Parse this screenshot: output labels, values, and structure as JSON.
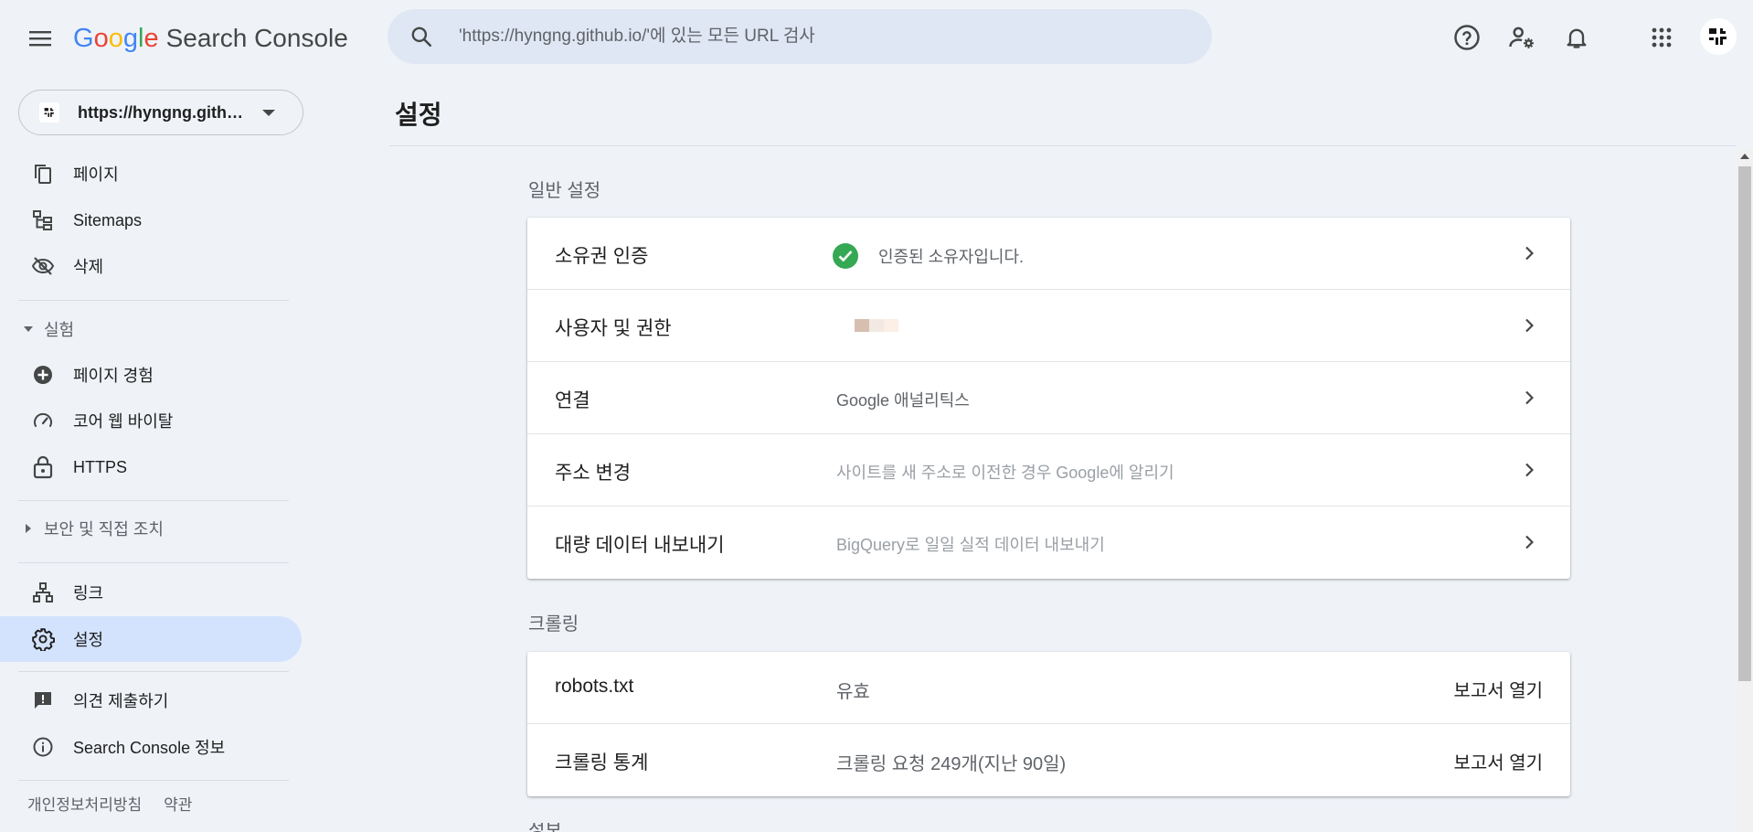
{
  "header": {
    "logo_letters": [
      "G",
      "o",
      "o",
      "g",
      "l",
      "e"
    ],
    "product": "Search Console",
    "search_placeholder": "'https://hyngng.github.io/'에 있는 모든 URL 검사"
  },
  "sidebar": {
    "property_label": "https://hyngng.github.io/",
    "items": [
      {
        "label": "페이지",
        "icon": "pages-icon"
      },
      {
        "label": "Sitemaps",
        "icon": "sitemap-icon"
      },
      {
        "label": "삭제",
        "icon": "visibility-off-icon"
      }
    ],
    "section_experience": "실험",
    "experience_items": [
      {
        "label": "페이지 경험",
        "icon": "plus-circle-icon"
      },
      {
        "label": "코어 웹 바이탈",
        "icon": "speed-gauge-icon"
      },
      {
        "label": "HTTPS",
        "icon": "lock-icon"
      }
    ],
    "section_security": "보안 및 직접 조치",
    "links_label": "링크",
    "settings_label": "설정",
    "feedback_label": "의견 제출하기",
    "about_label": "Search Console 정보",
    "footer": {
      "privacy": "개인정보처리방침",
      "terms": "약관"
    }
  },
  "main": {
    "title": "설정",
    "general_title": "일반 설정",
    "general_rows": [
      {
        "name": "소유권 인증",
        "value": "인증된 소유자입니다."
      },
      {
        "name": "사용자 및 권한",
        "value": ""
      },
      {
        "name": "연결",
        "value": "Google 애널리틱스"
      },
      {
        "name": "주소 변경",
        "value": "사이트를 새 주소로 이전한 경우 Google에 알리기"
      },
      {
        "name": "대량 데이터 내보내기",
        "value": "BigQuery로 일일 실적 데이터 내보내기"
      }
    ],
    "crawl_title": "크롤링",
    "crawl_rows": [
      {
        "name": "robots.txt",
        "value": "유효",
        "action": "보고서 열기"
      },
      {
        "name": "크롤링 통계",
        "value": "크롤링 요청 249개(지난 90일)",
        "action": "보고서 열기"
      }
    ],
    "next_section_partial": "정보"
  },
  "colors": {
    "accent_green": "#34a853",
    "active_nav": "#d3e3fd",
    "page_bg": "#eff3f8",
    "search_bg": "#dfe7f4"
  }
}
